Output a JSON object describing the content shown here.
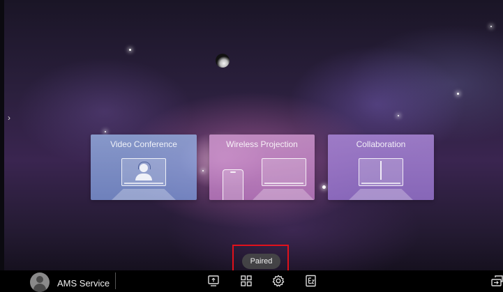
{
  "launcher": {
    "cards": [
      {
        "label": "Video Conference"
      },
      {
        "label": "Wireless Projection"
      },
      {
        "label": "Collaboration"
      }
    ]
  },
  "toast": {
    "text": "Paired"
  },
  "bottom_bar": {
    "user_name": "AMS Service",
    "icons": [
      "screen-share-icon",
      "apps-grid-icon",
      "settings-gear-icon",
      "ez-write-icon",
      "input-source-icon"
    ]
  },
  "side_panel": {
    "arrow": "›"
  },
  "colors": {
    "highlight": "#e1111b",
    "toast_bg": "#464648",
    "bar_bg": "#000000"
  }
}
